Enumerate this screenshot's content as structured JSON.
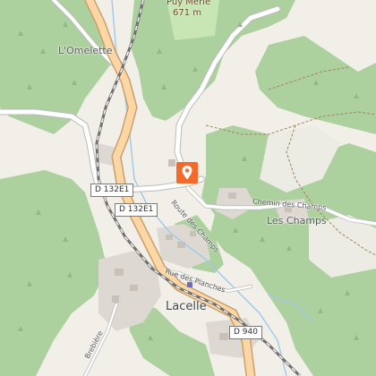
{
  "map": {
    "places": {
      "omelette": "L'Omelette",
      "les_champs": "Les Champs",
      "lacelle": "Lacelle",
      "puy_merle": "Puy Merle",
      "puy_merle_elevation": "671 m"
    },
    "roads": {
      "d132e1_a": "D 132E1",
      "d132e1_b": "D 132E1",
      "d940": "D 940"
    },
    "streets": {
      "route_des_champs": "Route des Champs",
      "chemin_des_champs": "Chemin des Champs",
      "rue_des_planches": "Rue des Planches",
      "brebiere": "Brebière"
    },
    "marker_icon": "map-pin-icon",
    "colors": {
      "forest": "#add19e",
      "background": "#f2efe9",
      "main_road": "#fcd6a4",
      "main_road_casing": "#c9a06a",
      "marker": "#f26b2a"
    }
  }
}
